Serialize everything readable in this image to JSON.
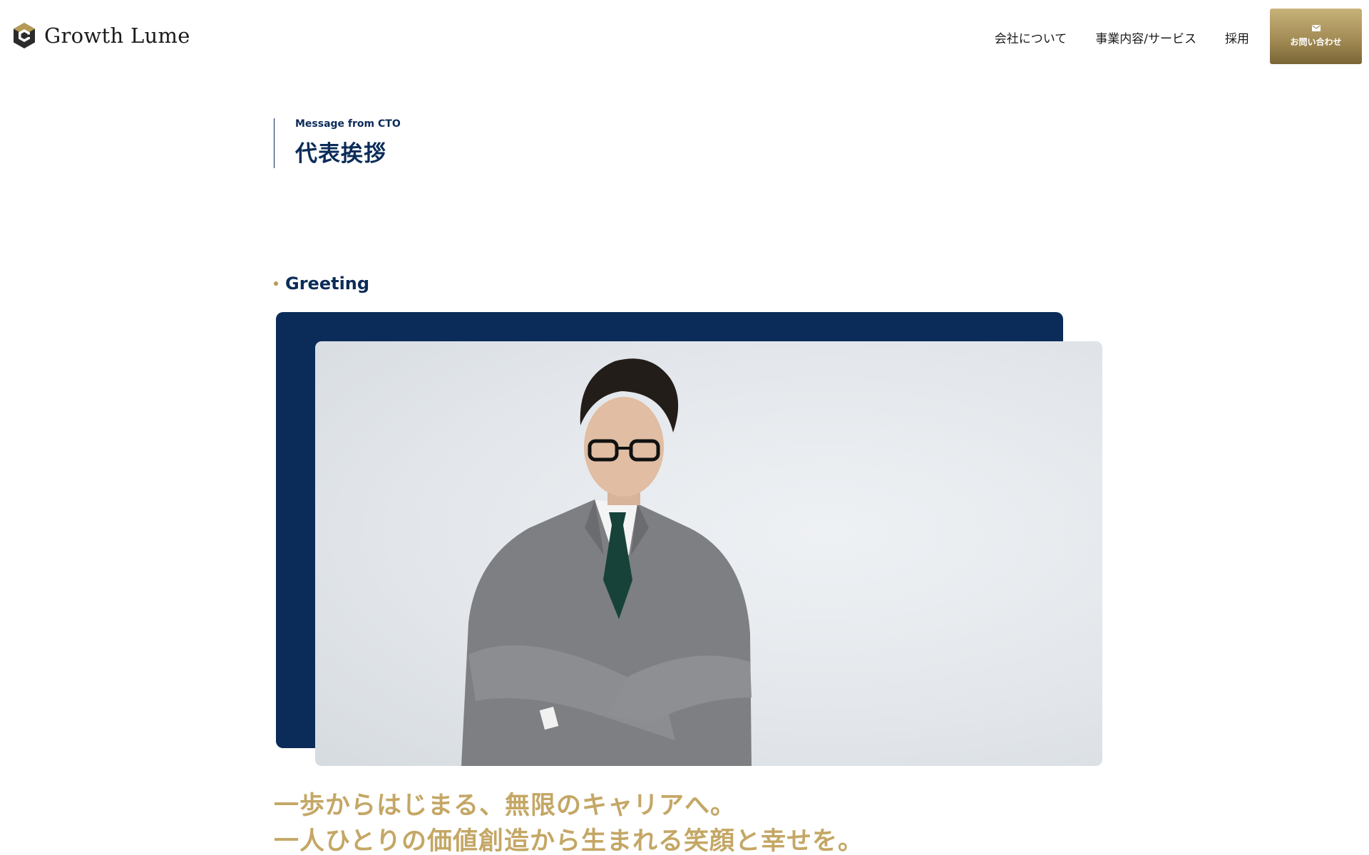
{
  "header": {
    "logo_text": "Growth Lume",
    "nav": [
      {
        "label": "会社について"
      },
      {
        "label": "事業内容/サービス"
      },
      {
        "label": "採用"
      }
    ],
    "contact_label": "お問い合わせ"
  },
  "page": {
    "subtitle": "Message from CTO",
    "title": "代表挨拶"
  },
  "section": {
    "label": "Greeting"
  },
  "catch": {
    "line1": "一歩からはじまる、無限のキャリアへ。",
    "line2": "一人ひとりの価値創造から生まれる笑顔と幸せを。"
  },
  "colors": {
    "navy": "#0b2c58",
    "gold": "#c4a765",
    "button_gold": "#a38c55"
  }
}
